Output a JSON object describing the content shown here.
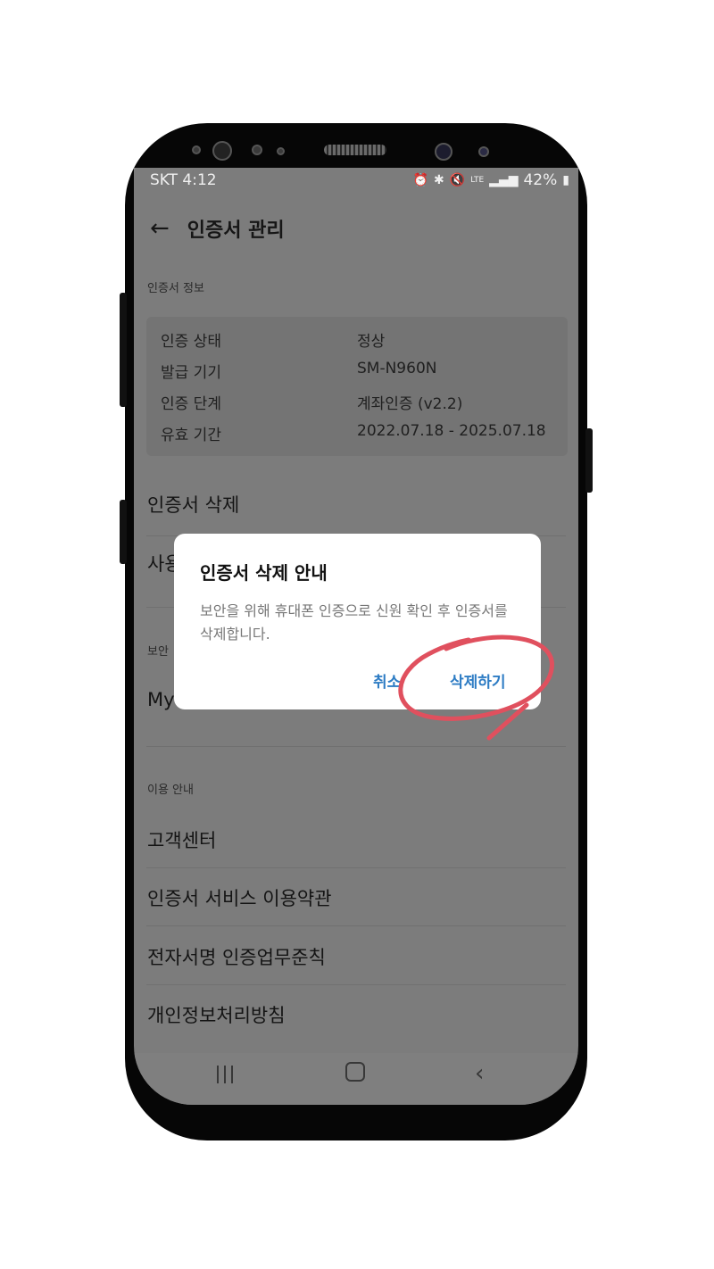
{
  "status_bar": {
    "carrier_time": "SKT 4:12",
    "lte": "LTE",
    "battery": "42%"
  },
  "header": {
    "title": "인증서 관리"
  },
  "cert_info": {
    "section_label": "인증서 정보",
    "rows": [
      {
        "label": "인증 상태",
        "value": "정상"
      },
      {
        "label": "발급 기기",
        "value": "SM-N960N"
      },
      {
        "label": "인증 단계",
        "value": "계좌인증 (v2.2)"
      },
      {
        "label": "유효 기간",
        "value": "2022.07.18 - 2025.07.18"
      }
    ]
  },
  "menu": {
    "delete": "인증서 삭제",
    "partial_item_1": "사용",
    "security_label_partial": "보안",
    "partial_item_2": "My"
  },
  "usage": {
    "section_label": "이용 안내",
    "items": [
      "고객센터",
      "인증서 서비스 이용약관",
      "전자서명 인증업무준칙",
      "개인정보처리방침"
    ]
  },
  "dialog": {
    "title": "인증서 삭제 안내",
    "body": "보안을 위해 휴대폰 인증으로 신원 확인 후 인증서를 삭제합니다.",
    "cancel": "취소",
    "confirm": "삭제하기"
  },
  "colors": {
    "accent": "#2d7cc4",
    "annotation": "#e0505e",
    "scrim_screen": "#7c7c7c"
  }
}
